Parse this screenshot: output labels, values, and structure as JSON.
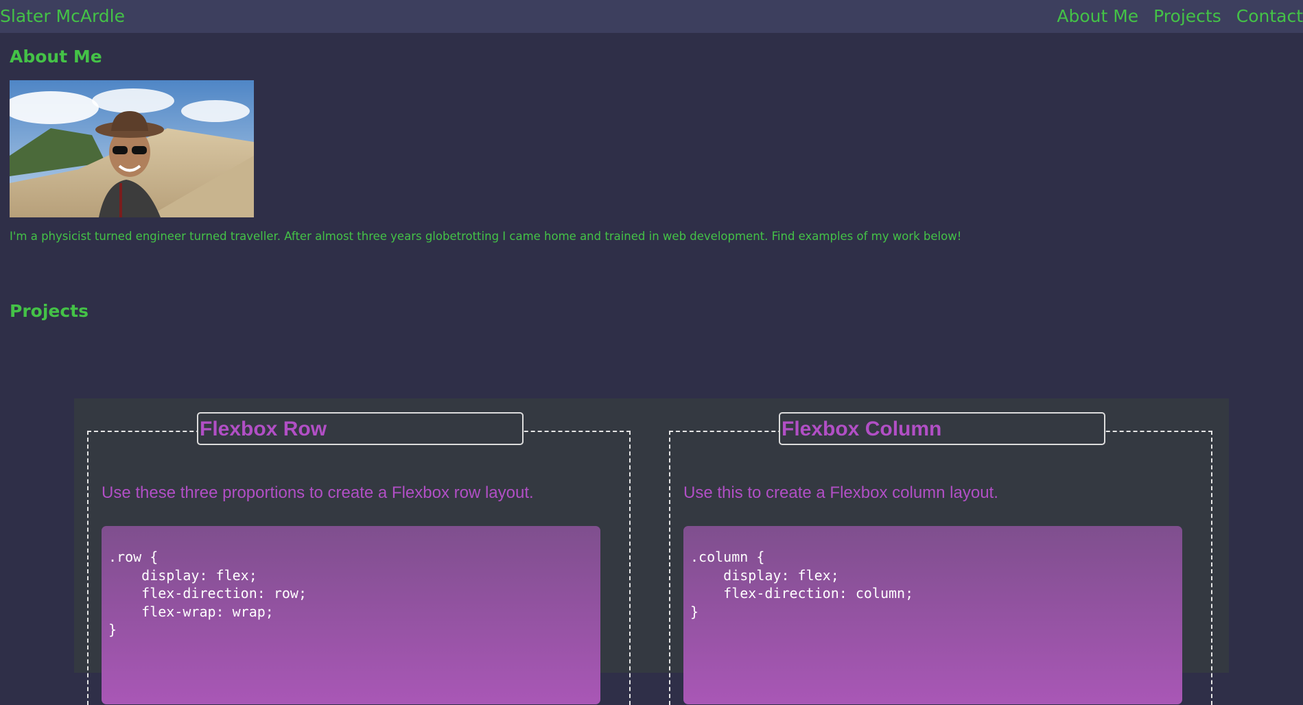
{
  "nav": {
    "brand": "Slater McArdle",
    "links": [
      "About Me",
      "Projects",
      "Contact"
    ]
  },
  "about": {
    "title": "About Me",
    "photo_alt": "Photo of a smiling man in a cowboy hat and sunglasses in front of sand dunes",
    "bio": "I'm a physicist turned engineer turned traveller. After almost three years globetrotting I came home and trained in web development. Find examples of my work below!"
  },
  "projects": {
    "title": "Projects",
    "cards": [
      {
        "title": "Flexbox Row",
        "description": "Use these three proportions to create a Flexbox row layout.",
        "code": ".row {\n    display: flex;\n    flex-direction: row;\n    flex-wrap: wrap;\n}"
      },
      {
        "title": "Flexbox Column",
        "description": "Use this to create a Flexbox column layout.",
        "code": ".column {\n    display: flex;\n    flex-direction: column;\n}"
      }
    ]
  },
  "colors": {
    "background": "#2f2f48",
    "navbar": "#3d3f5e",
    "accent_green": "#44c247",
    "accent_purple": "#b14fc5",
    "panel": "#343941"
  }
}
